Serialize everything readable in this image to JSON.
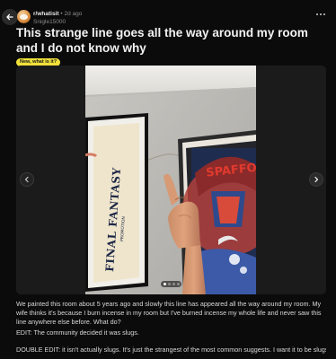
{
  "post": {
    "subreddit": "r/whatisit",
    "separator": "•",
    "age": "2d ago",
    "username": "Snigle15000",
    "title": "This strange line goes all the way around my room and I do not know why",
    "flair": "New, what is it?",
    "flair_color": "#f2e23a",
    "body": [
      "We painted this room about 5 years ago and slowly this line has appeared all the way around my room. My wife thinks it's because I burn incense in my room but I've burned incense my whole life and never saw this line anywhere else before. What do?",
      "EDIT: The community decided it was slugs.",
      "DOUBLE EDIT: it isn't actually slugs. It's just the strangest of the most common suggests. I want it to be slugs"
    ]
  },
  "media": {
    "image_count": 4,
    "current_index": 1,
    "poster_text": "FINAL FANTASY",
    "poster_subtext": "PROMOTION",
    "right_poster_text": "SPAFFO"
  },
  "icons": {
    "back": "arrow-left-icon",
    "more": "more-horizontal-icon",
    "prev": "chevron-left-icon",
    "next": "chevron-right-icon"
  },
  "colors": {
    "background": "#0b0b0b",
    "accent": "#f2e23a"
  }
}
